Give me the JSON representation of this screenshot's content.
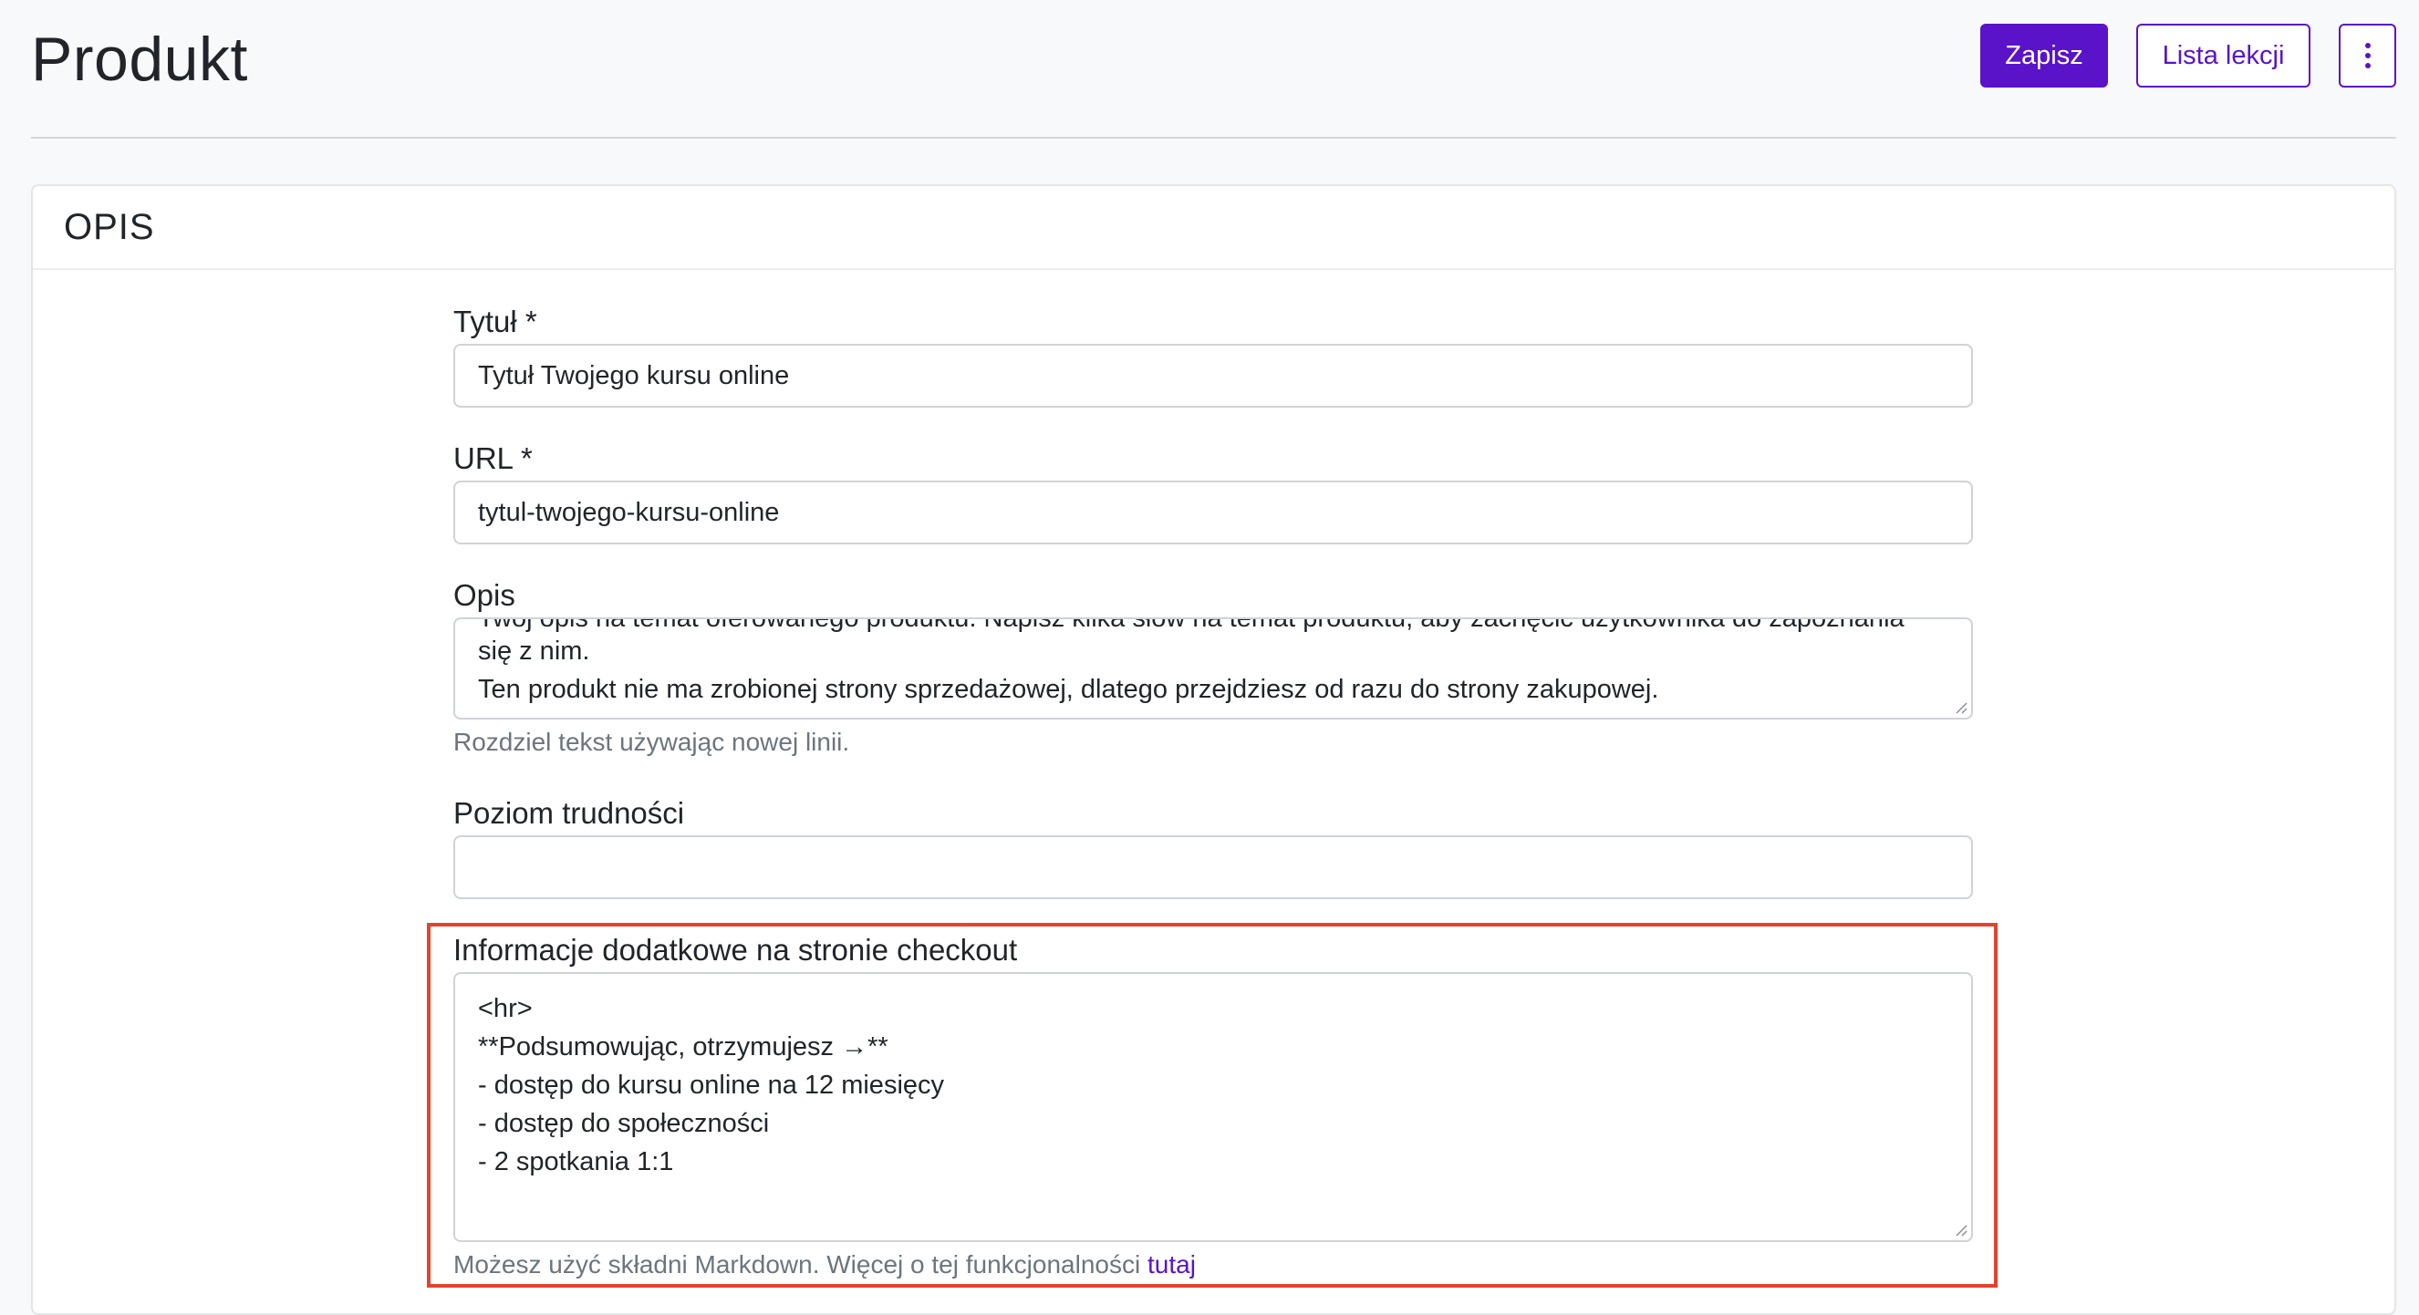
{
  "header": {
    "title": "Produkt",
    "save_label": "Zapisz",
    "lessons_label": "Lista lekcji"
  },
  "colors": {
    "accent": "#5a13c9",
    "highlight": "#e2422e"
  },
  "section": {
    "title": "OPIS"
  },
  "fields": {
    "title": {
      "label": "Tytuł *",
      "value": "Tytuł Twojego kursu online"
    },
    "url": {
      "label": "URL *",
      "value": "tytul-twojego-kursu-online"
    },
    "description": {
      "label": "Opis",
      "line_partial": "Twój opis na temat oferowanego produktu. Napisz kilka słów na temat produktu, aby zachęcić użytkownika do zapoznania",
      "line1": "się z nim.",
      "line2": "Ten produkt nie ma zrobionej strony sprzedażowej, dlatego przejdziesz od razu do strony zakupowej.",
      "help": "Rozdziel tekst używając nowej linii."
    },
    "difficulty": {
      "label": "Poziom trudności",
      "value": ""
    },
    "checkout_info": {
      "label": "Informacje dodatkowe na stronie checkout",
      "lines": [
        "<hr>",
        "**Podsumowując, otrzymujesz →**",
        "- dostęp do kursu online na 12 miesięcy",
        "- dostęp do społeczności",
        "- 2 spotkania 1:1"
      ],
      "help_text": "Możesz użyć składni Markdown. Więcej o tej funkcjonalności ",
      "help_link": "tutaj"
    }
  }
}
